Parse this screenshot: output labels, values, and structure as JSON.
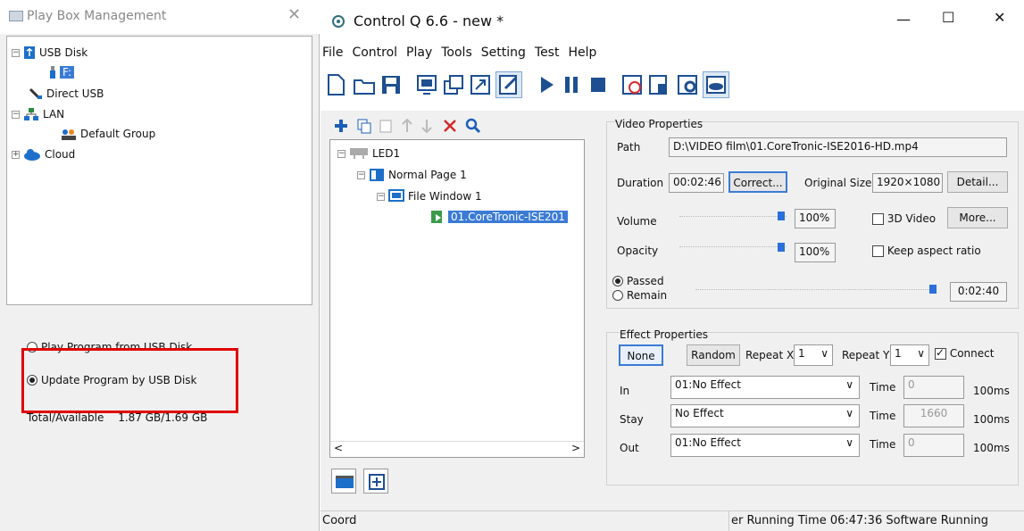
{
  "left": {
    "title": "Play Box Management",
    "tree": [
      {
        "label": "USB Disk"
      },
      {
        "label": "F:"
      },
      {
        "label": "Direct USB"
      },
      {
        "label": "LAN"
      },
      {
        "label": "Default Group"
      },
      {
        "label": "Cloud"
      }
    ],
    "options": [
      {
        "label": "Play Program from USB Disk",
        "selected": false
      },
      {
        "label": "Update Program by USB Disk",
        "selected": true
      }
    ],
    "total_label": "Total/Available",
    "total_value": "1.87 GB/1.69 GB"
  },
  "right": {
    "title": "Control Q 6.6 - new *",
    "window_controls": {
      "minimize": "—",
      "maximize": "☐",
      "close": "✕"
    },
    "menu": [
      "File",
      "Control",
      "Play",
      "Tools",
      "Setting",
      "Test",
      "Help"
    ],
    "program_tree": [
      {
        "label": "LED1"
      },
      {
        "label": "Normal Page 1"
      },
      {
        "label": "File Window 1"
      },
      {
        "label": "01.CoreTronic-ISE201"
      }
    ],
    "video": {
      "group_title": "Video Properties",
      "path_label": "Path",
      "path_value": "D:\\VIDEO film\\01.CoreTronic-ISE2016-HD.mp4",
      "duration_label": "Duration",
      "duration_value": "00:02:46",
      "correct_button": "Correct...",
      "original_size_label": "Original Size",
      "original_size_value": "1920×1080",
      "detail_button": "Detail...",
      "volume_label": "Volume",
      "volume_value": "100%",
      "video3d_label": "3D Video",
      "more_button": "More...",
      "opacity_label": "Opacity",
      "opacity_value": "100%",
      "keep_aspect_label": "Keep aspect ratio",
      "passed_label": "Passed",
      "remain_label": "Remain",
      "time_value": "0:02:40"
    },
    "effect": {
      "group_title": "Effect Properties",
      "none_button": "None",
      "random_button": "Random",
      "repeat_x_label": "Repeat X",
      "repeat_x_value": "1",
      "repeat_y_label": "Repeat Y",
      "repeat_y_value": "1",
      "connect_label": "Connect",
      "rows": [
        {
          "label": "In",
          "value": "01:No Effect",
          "time_label": "Time",
          "time_value": "0",
          "unit": "100ms"
        },
        {
          "label": "Stay",
          "value": "No Effect",
          "time_label": "Time",
          "time_value": "1660",
          "unit": "100ms"
        },
        {
          "label": "Out",
          "value": "01:No Effect",
          "time_label": "Time",
          "time_value": "0",
          "unit": "100ms"
        }
      ]
    },
    "status_left": "Coord",
    "status_right": "er Running Time 06:47:36 Software Running"
  }
}
